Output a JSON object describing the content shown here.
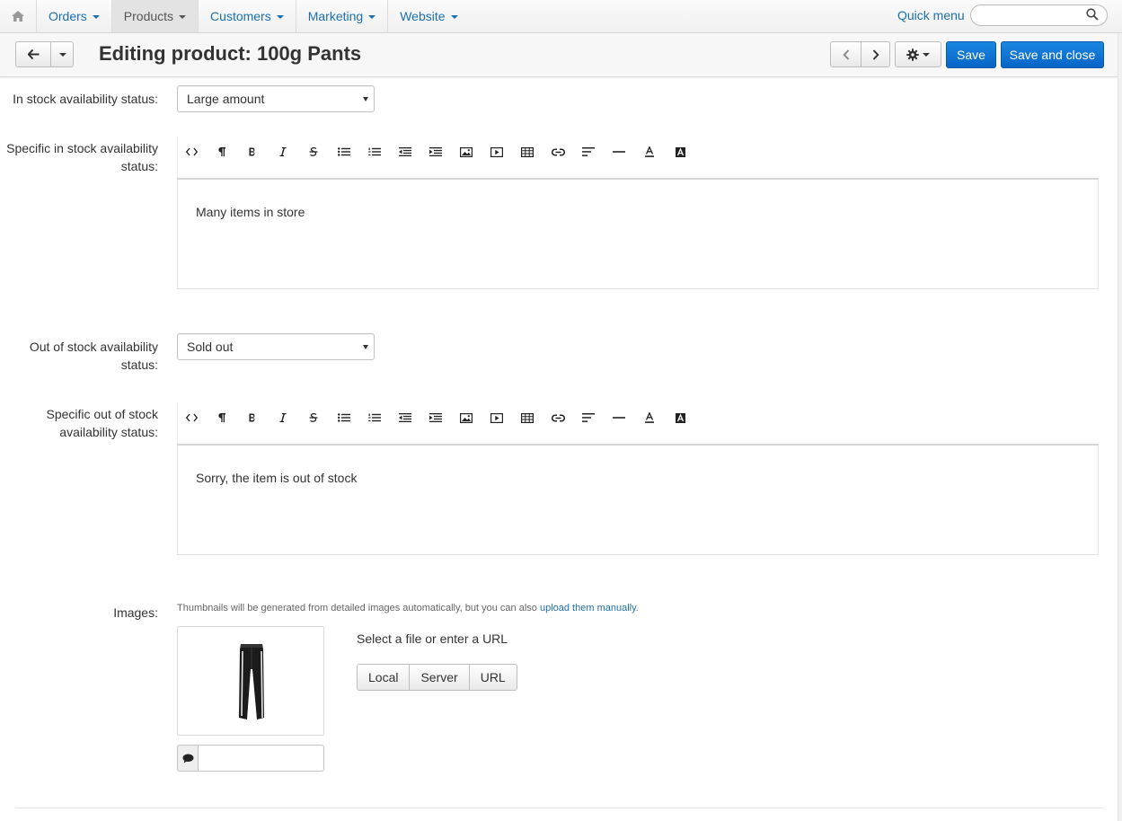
{
  "nav": {
    "items": [
      {
        "label": "Orders",
        "active": false
      },
      {
        "label": "Products",
        "active": true
      },
      {
        "label": "Customers",
        "active": false
      },
      {
        "label": "Marketing",
        "active": false
      },
      {
        "label": "Website",
        "active": false
      }
    ],
    "quick_menu": "Quick menu",
    "search_value": ""
  },
  "header": {
    "title": "Editing product: 100g Pants",
    "save_label": "Save",
    "save_close_label": "Save and close"
  },
  "form": {
    "in_stock": {
      "label": "In stock availability status:",
      "selected": "Large amount"
    },
    "specific_in_stock": {
      "label": "Specific in stock availability status:",
      "content": "Many items in store"
    },
    "out_of_stock": {
      "label": "Out of stock availability status:",
      "selected": "Sold out"
    },
    "specific_out_of_stock": {
      "label": "Specific out of stock availability status:",
      "content": "Sorry, the item is out of stock"
    },
    "images": {
      "label": "Images:",
      "hint_text": "Thumbnails will be generated from detailed images automatically, but you can also ",
      "hint_link": "upload them manually",
      "hint_end": ".",
      "file_hint": "Select a file or enter a URL",
      "sources": [
        "Local",
        "Server",
        "URL"
      ],
      "alt_value": ""
    }
  },
  "toolbar_icons": [
    "html-code-icon",
    "paragraph-icon",
    "bold-icon",
    "italic-icon",
    "strikethrough-icon",
    "unordered-list-icon",
    "ordered-list-icon",
    "outdent-icon",
    "indent-icon",
    "image-icon",
    "video-icon",
    "table-icon",
    "link-icon",
    "align-icon",
    "horizontal-rule-icon",
    "font-color-icon",
    "background-color-icon"
  ],
  "colors": {
    "link": "#1c6faf",
    "primary_button": "#0765c7",
    "active_nav": "#e3e3e3"
  }
}
